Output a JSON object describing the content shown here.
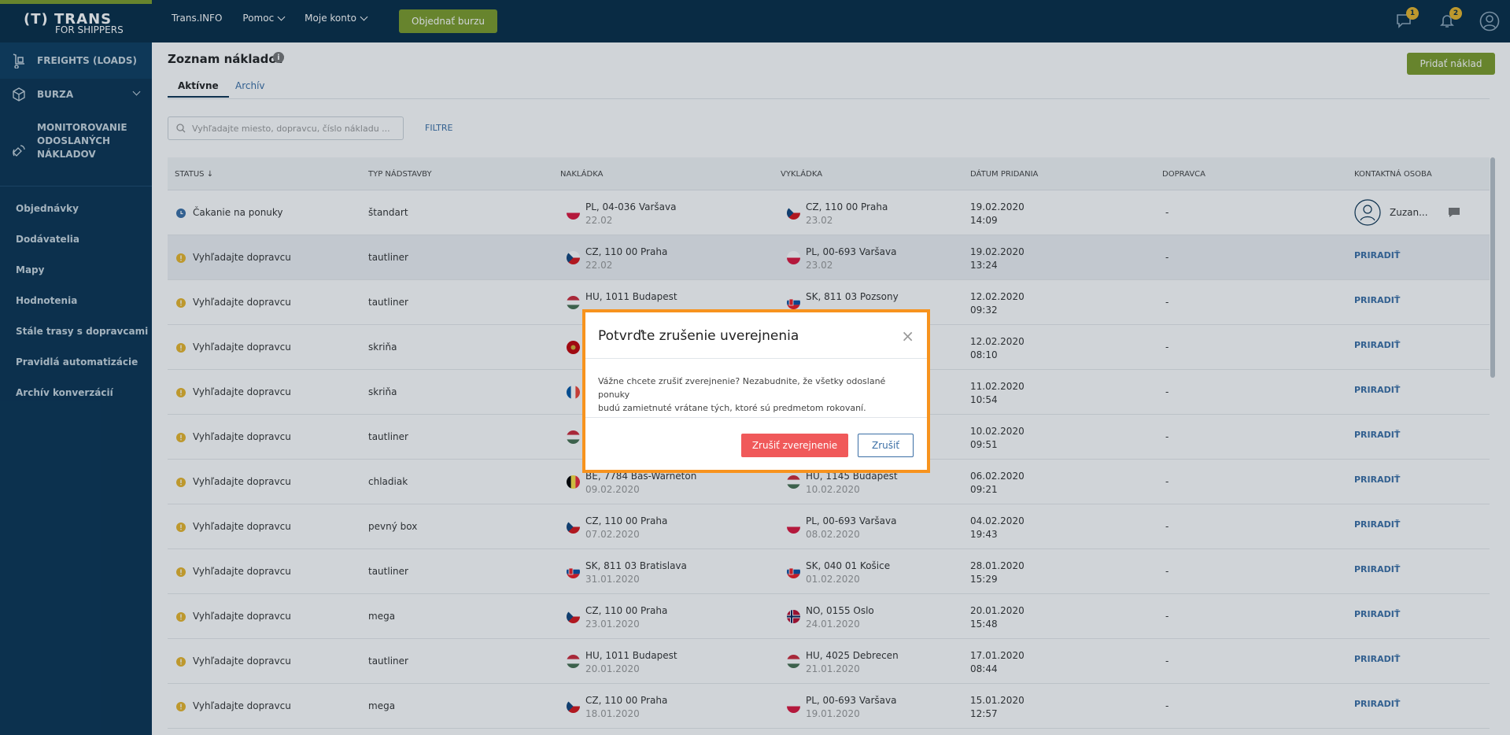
{
  "topbar": {
    "logo_line1": "(T) TRANS",
    "logo_line2": "FOR SHIPPERS",
    "nav": [
      {
        "label": "Trans.INFO",
        "has_chevron": false
      },
      {
        "label": "Pomoc",
        "has_chevron": true
      },
      {
        "label": "Moje konto",
        "has_chevron": true
      }
    ],
    "cta_label": "Objednať burzu",
    "messages_badge": "1",
    "notifications_badge": "2",
    "accent_color": "#7c9c2a",
    "badge_color": "#e8b52a"
  },
  "sidebar": {
    "main_items": [
      {
        "label": "FREIGHTS (LOADS)",
        "icon": "dolly-icon"
      },
      {
        "label": "BURZA",
        "icon": "cube-icon"
      },
      {
        "label": "MONITOROVANIE ODOSLANÝCH NÁKLADOV",
        "icon": "satellite-icon"
      }
    ],
    "links": [
      "Objednávky",
      "Dodávatelia",
      "Mapy",
      "Hodnotenia",
      "Stále trasy s dopravcami",
      "Pravidlá automatizácie",
      "Archív konverzácií"
    ]
  },
  "page": {
    "title": "Zoznam nákladov",
    "tabs": [
      "Aktívne",
      "Archív"
    ],
    "add_button": "Pridať náklad",
    "search_placeholder": "Vyhľadajte miesto, dopravcu, číslo nákladu ...",
    "filter_label": "FILTRE"
  },
  "table": {
    "headers": [
      "STATUS ↓",
      "TYP NÁDSTAVBY",
      "NAKLÁDKA",
      "VYKLÁDKA",
      "DÁTUM PRIDANIA",
      "DOPRAVCA",
      "KONTAKTNÁ OSOBA"
    ],
    "rows": [
      {
        "status": "Čakanie na ponuky",
        "status_type": "waiting",
        "typ": "štandart",
        "load_flag": "PL",
        "load_place": "PL, 04-036 Varšava",
        "load_date": "22.02",
        "unload_flag": "CZ",
        "unload_place": "CZ, 110 00 Praha",
        "unload_date": "23.02",
        "added_date": "19.02.2020",
        "added_time": "14:09",
        "carrier": "-",
        "contact": "Zuzan...",
        "highlight": false
      },
      {
        "status": "Vyhľadajte dopravcu",
        "status_type": "search",
        "typ": "tautliner",
        "load_flag": "CZ",
        "load_place": "CZ, 110 00 Praha",
        "load_date": "22.02",
        "unload_flag": "PL",
        "unload_place": "PL, 00-693 Varšava",
        "unload_date": "23.02",
        "added_date": "19.02.2020",
        "added_time": "13:24",
        "carrier": "-",
        "contact": "PRIRADIŤ",
        "highlight": true
      },
      {
        "status": "Vyhľadajte dopravcu",
        "status_type": "search",
        "typ": "tautliner",
        "load_flag": "HU",
        "load_place": "HU, 1011 Budapest",
        "load_date": "",
        "unload_flag": "SK",
        "unload_place": "SK, 811 03 Pozsony",
        "unload_date": "",
        "added_date": "12.02.2020",
        "added_time": "09:32",
        "carrier": "-",
        "contact": "PRIRADIŤ",
        "highlight": false
      },
      {
        "status": "Vyhľadajte dopravcu",
        "status_type": "search",
        "typ": "skriňa",
        "load_flag": "ME",
        "load_place": "",
        "load_date": "",
        "unload_flag": "",
        "unload_place": "",
        "unload_date": "",
        "added_date": "12.02.2020",
        "added_time": "08:10",
        "carrier": "-",
        "contact": "PRIRADIŤ",
        "highlight": false
      },
      {
        "status": "Vyhľadajte dopravcu",
        "status_type": "search",
        "typ": "skriňa",
        "load_flag": "FR",
        "load_place": "",
        "load_date": "",
        "unload_flag": "",
        "unload_place": "",
        "unload_date": "",
        "added_date": "11.02.2020",
        "added_time": "10:54",
        "carrier": "-",
        "contact": "PRIRADIŤ",
        "highlight": false
      },
      {
        "status": "Vyhľadajte dopravcu",
        "status_type": "search",
        "typ": "tautliner",
        "load_flag": "HU",
        "load_place": "",
        "load_date": "",
        "unload_flag": "",
        "unload_place": "",
        "unload_date": "",
        "added_date": "10.02.2020",
        "added_time": "09:51",
        "carrier": "-",
        "contact": "PRIRADIŤ",
        "highlight": false
      },
      {
        "status": "Vyhľadajte dopravcu",
        "status_type": "search",
        "typ": "chladiak",
        "load_flag": "BE",
        "load_place": "BE, 7784 Bas-Warneton",
        "load_date": "09.02.2020",
        "unload_flag": "HU",
        "unload_place": "HU, 1145 Budapest",
        "unload_date": "10.02.2020",
        "added_date": "06.02.2020",
        "added_time": "09:21",
        "carrier": "-",
        "contact": "PRIRADIŤ",
        "highlight": false
      },
      {
        "status": "Vyhľadajte dopravcu",
        "status_type": "search",
        "typ": "pevný box",
        "load_flag": "CZ",
        "load_place": "CZ, 110 00 Praha",
        "load_date": "07.02.2020",
        "unload_flag": "PL",
        "unload_place": "PL, 00-693 Varšava",
        "unload_date": "08.02.2020",
        "added_date": "04.02.2020",
        "added_time": "19:43",
        "carrier": "-",
        "contact": "PRIRADIŤ",
        "highlight": false
      },
      {
        "status": "Vyhľadajte dopravcu",
        "status_type": "search",
        "typ": "tautliner",
        "load_flag": "SK",
        "load_place": "SK, 811 03 Bratislava",
        "load_date": "31.01.2020",
        "unload_flag": "SK",
        "unload_place": "SK, 040 01 Košice",
        "unload_date": "01.02.2020",
        "added_date": "28.01.2020",
        "added_time": "15:29",
        "carrier": "-",
        "contact": "PRIRADIŤ",
        "highlight": false
      },
      {
        "status": "Vyhľadajte dopravcu",
        "status_type": "search",
        "typ": "mega",
        "load_flag": "CZ",
        "load_place": "CZ, 110 00 Praha",
        "load_date": "23.01.2020",
        "unload_flag": "NO",
        "unload_place": "NO, 0155 Oslo",
        "unload_date": "24.01.2020",
        "added_date": "20.01.2020",
        "added_time": "15:48",
        "carrier": "-",
        "contact": "PRIRADIŤ",
        "highlight": false
      },
      {
        "status": "Vyhľadajte dopravcu",
        "status_type": "search",
        "typ": "tautliner",
        "load_flag": "HU",
        "load_place": "HU, 1011 Budapest",
        "load_date": "20.01.2020",
        "unload_flag": "HU",
        "unload_place": "HU, 4025 Debrecen",
        "unload_date": "21.01.2020",
        "added_date": "17.01.2020",
        "added_time": "08:44",
        "carrier": "-",
        "contact": "PRIRADIŤ",
        "highlight": false
      },
      {
        "status": "Vyhľadajte dopravcu",
        "status_type": "search",
        "typ": "mega",
        "load_flag": "CZ",
        "load_place": "CZ, 110 00 Praha",
        "load_date": "18.01.2020",
        "unload_flag": "PL",
        "unload_place": "PL, 00-693 Varšava",
        "unload_date": "19.01.2020",
        "added_date": "15.01.2020",
        "added_time": "12:57",
        "carrier": "-",
        "contact": "PRIRADIŤ",
        "highlight": false
      }
    ]
  },
  "modal": {
    "title": "Potvrďte zrušenie uverejnenia",
    "close": "×",
    "body_line1": "Vážne chcete zrušiť zverejnenie? Nezabudnite, že všetky odoslané ponuky",
    "body_line2": "budú zamietnuté vrátane tých, ktoré sú predmetom rokovaní.",
    "confirm_label": "Zrušiť zverejnenie",
    "cancel_label": "Zrušiť",
    "border_color": "#f7931e",
    "danger_color": "#f0595a"
  }
}
